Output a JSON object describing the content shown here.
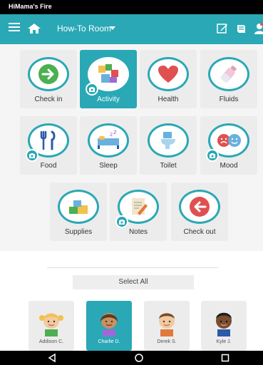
{
  "status_bar": {
    "title": "HiMama's Fire"
  },
  "app_bar": {
    "room_name": "How-To Room",
    "icons": [
      "menu-icon",
      "home-icon",
      "chevron-down-icon",
      "edit-icon",
      "book-icon",
      "user-icon"
    ]
  },
  "tiles": [
    {
      "label": "Check in",
      "icon": "arrow-right-icon",
      "selected": false,
      "camera": false
    },
    {
      "label": "Activity",
      "icon": "blocks-icon",
      "selected": true,
      "camera": true
    },
    {
      "label": "Health",
      "icon": "heart-icon",
      "selected": false,
      "camera": false
    },
    {
      "label": "Fluids",
      "icon": "bottle-icon",
      "selected": false,
      "camera": false
    },
    {
      "label": "Food",
      "icon": "utensils-icon",
      "selected": false,
      "camera": true
    },
    {
      "label": "Sleep",
      "icon": "bed-icon",
      "selected": false,
      "camera": false
    },
    {
      "label": "Toilet",
      "icon": "toilet-icon",
      "selected": false,
      "camera": false
    },
    {
      "label": "Mood",
      "icon": "mood-faces-icon",
      "selected": false,
      "camera": true
    },
    {
      "label": "Supplies",
      "icon": "supplies-icon",
      "selected": false,
      "camera": false
    },
    {
      "label": "Notes",
      "icon": "notepad-icon",
      "selected": false,
      "camera": true
    },
    {
      "label": "Check out",
      "icon": "arrow-left-icon",
      "selected": false,
      "camera": false
    }
  ],
  "select_all": "Select All",
  "children": [
    {
      "name": "Addison C.",
      "selected": false
    },
    {
      "name": "Charlie D.",
      "selected": true
    },
    {
      "name": "Derek S.",
      "selected": false
    },
    {
      "name": "Kyle J.",
      "selected": false
    }
  ],
  "colors": {
    "accent": "#2aa8b5",
    "tile_bg": "#ececec",
    "page_bg": "#f5f5f5"
  }
}
